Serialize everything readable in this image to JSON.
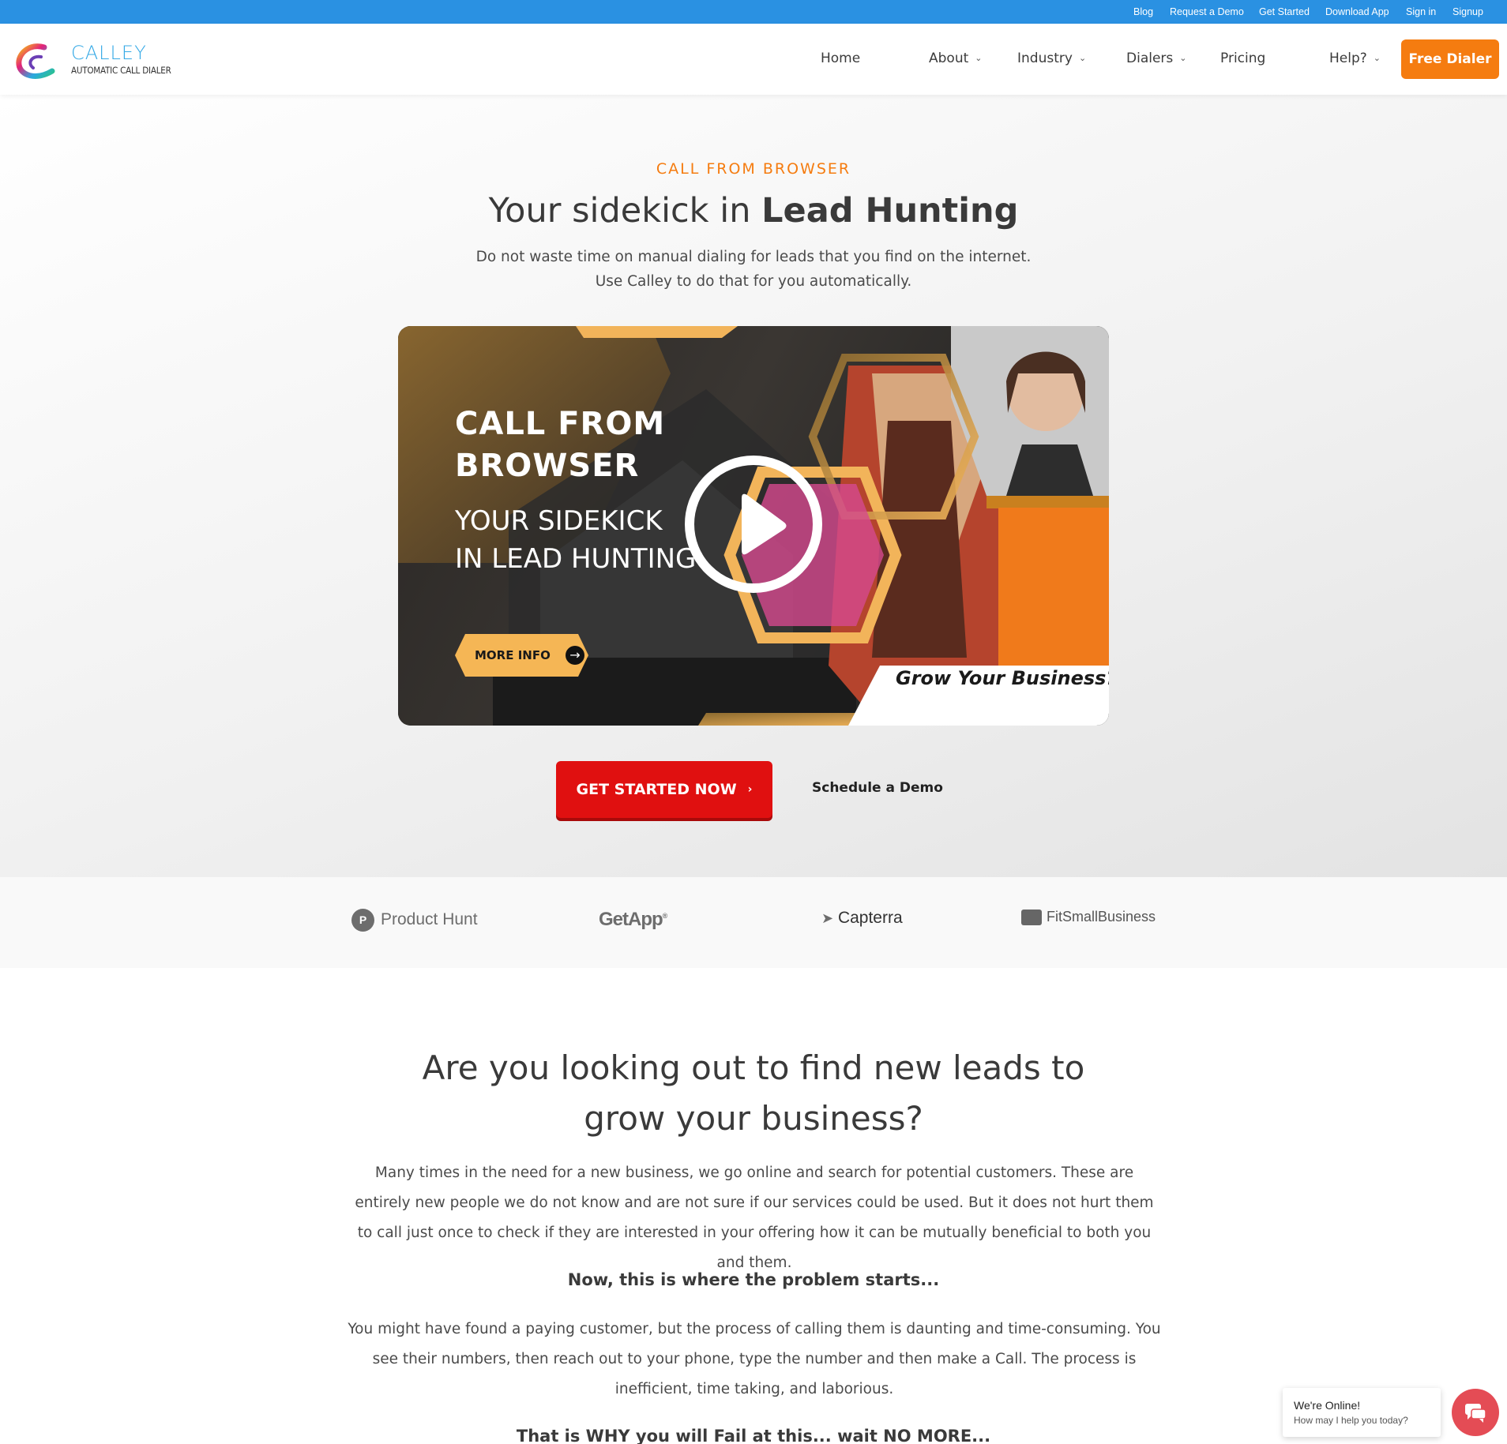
{
  "colors": {
    "topbar": "#2a91e2",
    "accent": "#f57c10",
    "primary_button": "#e01010",
    "chat": "#e44c55"
  },
  "topbar": {
    "links": [
      "Blog",
      "Request a Demo",
      "Get Started",
      "Download App",
      "Sign in",
      "Signup"
    ]
  },
  "header": {
    "logo_name": "CALLEY",
    "logo_tagline": "AUTOMATIC CALL DIALER",
    "nav": [
      "Home",
      "About",
      "Industry",
      "Dialers",
      "Pricing",
      "Help?"
    ],
    "cta": "Free Dialer"
  },
  "hero": {
    "eyebrow": "CALL FROM BROWSER",
    "title_light": "Your sidekick in ",
    "title_bold": "Lead Hunting",
    "subtitle_line1": "Do not waste time on manual dialing for leads that you find on the internet.",
    "subtitle_line2": "Use Calley to do that for you automatically.",
    "video": {
      "title_line1": "CALL FROM",
      "title_line2": "BROWSER",
      "sub_line1": "YOUR SIDEKICK",
      "sub_line2": "IN LEAD HUNTING",
      "more_info": "MORE INFO",
      "tagline": "Grow Your Business?",
      "play_icon": "play-icon"
    },
    "primary_button": "GET STARTED NOW",
    "secondary_link": "Schedule a Demo"
  },
  "logos": [
    "Product Hunt",
    "GetApp",
    "Capterra",
    "FitSmallBusiness"
  ],
  "content": {
    "title_line1": "Are you looking out to find new leads to",
    "title_line2": "grow your business?",
    "paragraph1": "Many times in the need for a new business, we go online and search for potential customers. These are entirely new people we do not know and are not sure if our services could be used. But it does not hurt them to call just once to check if they are interested in your offering how it can be mutually beneficial to both you and them.",
    "problem": "Now, this is where the problem starts...",
    "paragraph2": "You might have found a paying customer, but the process of calling them is daunting and time-consuming. You see their numbers, then reach out to your phone, type the number and then make a Call. The process is inefficient, time taking, and laborious.",
    "why": "That is WHY you will Fail at this... wait NO MORE..."
  },
  "chat": {
    "status": "We're Online!",
    "prompt": "How may I help you today?"
  }
}
